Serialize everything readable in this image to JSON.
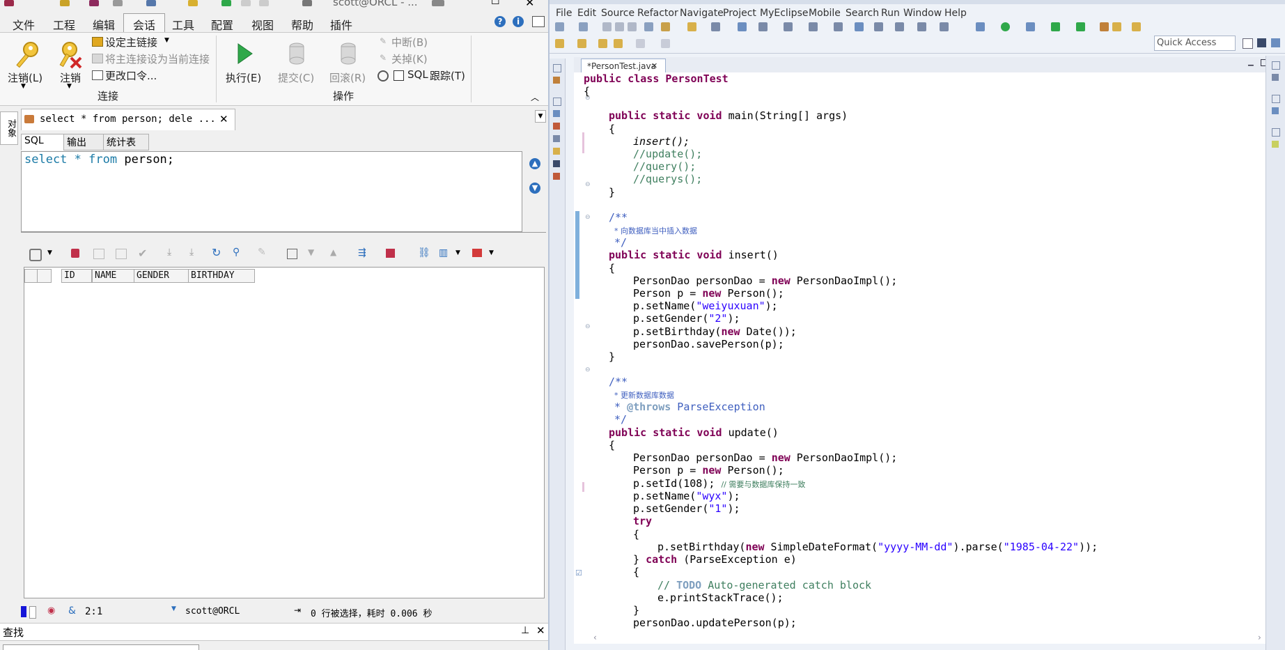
{
  "left_app": {
    "window": {
      "title": "scott@ORCL - ..."
    },
    "menu": [
      "文件",
      "工程",
      "编辑",
      "会话",
      "工具",
      "配置",
      "视图",
      "帮助",
      "插件"
    ],
    "active_menu": "会话",
    "ribbon": {
      "logoff1": "注销(L)",
      "logoff2": "注销",
      "set_main": "设定主链接",
      "set_current": "将主连接设为当前连接",
      "change_pwd": "更改口令...",
      "group_connect": "连接",
      "execute": "执行(E)",
      "commit": "提交(C)",
      "rollback": "回滚(R)",
      "break": "中断(B)",
      "close": "关掉(K)",
      "sql_label": "SQL",
      "trace": "跟踪(T)",
      "group_ops": "操作"
    },
    "side_tab": "对象",
    "doc_tab": {
      "title": "select * from person; dele ..."
    },
    "sub_tabs": [
      "SQL",
      "输出",
      "统计表"
    ],
    "sql_text": {
      "kw1": "select",
      "star": "*",
      "kw2": "from",
      "rest": "person;"
    },
    "grid_columns": [
      "",
      "ID",
      "NAME",
      "GENDER",
      "BIRTHDAY"
    ],
    "status": {
      "position": "2:1",
      "connection": "scott@ORCL",
      "message": "0 行被选择，耗时 0.006 秒"
    },
    "find": {
      "label": "查找"
    }
  },
  "eclipse": {
    "menu": [
      "File",
      "Edit",
      "Source",
      "Refactor",
      "Navigate",
      "Project",
      "MyEclipse",
      "Mobile",
      "Search",
      "Run",
      "Window",
      "Help"
    ],
    "quick_access": "Quick Access",
    "tab_title": "*PersonTest.java",
    "code": {
      "l01": "public class PersonTest",
      "l02": "{",
      "l03_a": "public static void ",
      "l03_b": "main(String[] args)",
      "l04": "{",
      "l05": "insert();",
      "l06": "//update();",
      "l07": "//query();",
      "l08": "//querys();",
      "l09": "}",
      "l10": "/**",
      "l11": "* 向数据库当中插入数据",
      "l12": "*/",
      "l13_a": "public static void ",
      "l13_b": "insert()",
      "l14": "{",
      "l15_a": "PersonDao personDao = ",
      "l15_b": "new",
      "l15_c": " PersonDaoImpl();",
      "l16_a": "Person p = ",
      "l16_b": "new",
      "l16_c": " Person();",
      "l17_a": "p.setName(",
      "l17_b": "\"weiyuxuan\"",
      "l17_c": ");",
      "l18_a": "p.setGender(",
      "l18_b": "\"2\"",
      "l18_c": ");",
      "l19_a": "p.setBirthday(",
      "l19_b": "new",
      "l19_c": " Date());",
      "l20": "personDao.savePerson(p);",
      "l21": "}",
      "l22": "/**",
      "l23": "* 更新数据库数据",
      "l24_a": "* ",
      "l24_b": "@throws",
      "l24_c": " ParseException",
      "l25": "*/",
      "l26_a": "public static void ",
      "l26_b": "update()",
      "l27": "{",
      "l28_a": "PersonDao personDao = ",
      "l28_b": "new",
      "l28_c": " PersonDaoImpl();",
      "l29_a": "Person p = ",
      "l29_b": "new",
      "l29_c": " Person();",
      "l30_a": "p.setId(108); ",
      "l30_b": "// 需要与数据库保持一致",
      "l31_a": "p.setName(",
      "l31_b": "\"wyx\"",
      "l31_c": ");",
      "l32_a": "p.setGender(",
      "l32_b": "\"1\"",
      "l32_c": ");",
      "l33": "try",
      "l34": "{",
      "l35_a": "p.setBirthday(",
      "l35_b": "new",
      "l35_c": " SimpleDateFormat(",
      "l35_d": "\"yyyy-MM-dd\"",
      "l35_e": ").parse(",
      "l35_f": "\"1985-04-22\"",
      "l35_g": "));",
      "l36_a": "} ",
      "l36_b": "catch",
      "l36_c": " (ParseException e)",
      "l37": "{",
      "l38_a": "// ",
      "l38_b": "TODO",
      "l38_c": " Auto-generated catch block",
      "l39": "e.printStackTrace();",
      "l40": "}",
      "l41": "personDao.updatePerson(p);"
    }
  },
  "colors": {
    "keyword": "#7f0055",
    "comment": "#3f7f5f",
    "javadoc": "#3f5fbf",
    "string": "#2a00ff",
    "sql_keyword": "#1a7aa6",
    "tab_accent": "#5b86c4"
  }
}
